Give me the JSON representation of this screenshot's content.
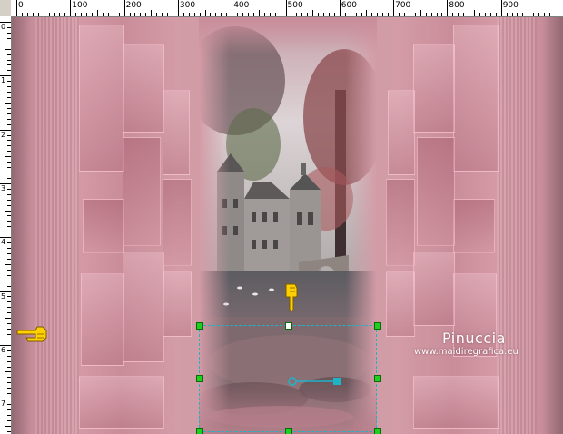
{
  "ruler": {
    "top_labels": [
      "0",
      "100",
      "200",
      "300",
      "400",
      "500",
      "600",
      "700",
      "800",
      "900"
    ],
    "left_labels": [
      "0",
      "1",
      "2",
      "3",
      "4",
      "5",
      "6",
      "7"
    ]
  },
  "watermark": {
    "name": "Pinuccia",
    "url": "www.maidiregrafica.eu"
  },
  "colors": {
    "canvas_pink": "#d39ca7",
    "selection_border": "#1fb3c8",
    "handle_green": "#20d020",
    "pointer_yellow": "#ffd000"
  },
  "icons": {
    "pointer_left": "hand-pointer-icon",
    "pointer_down": "hand-pointer-down-icon"
  }
}
